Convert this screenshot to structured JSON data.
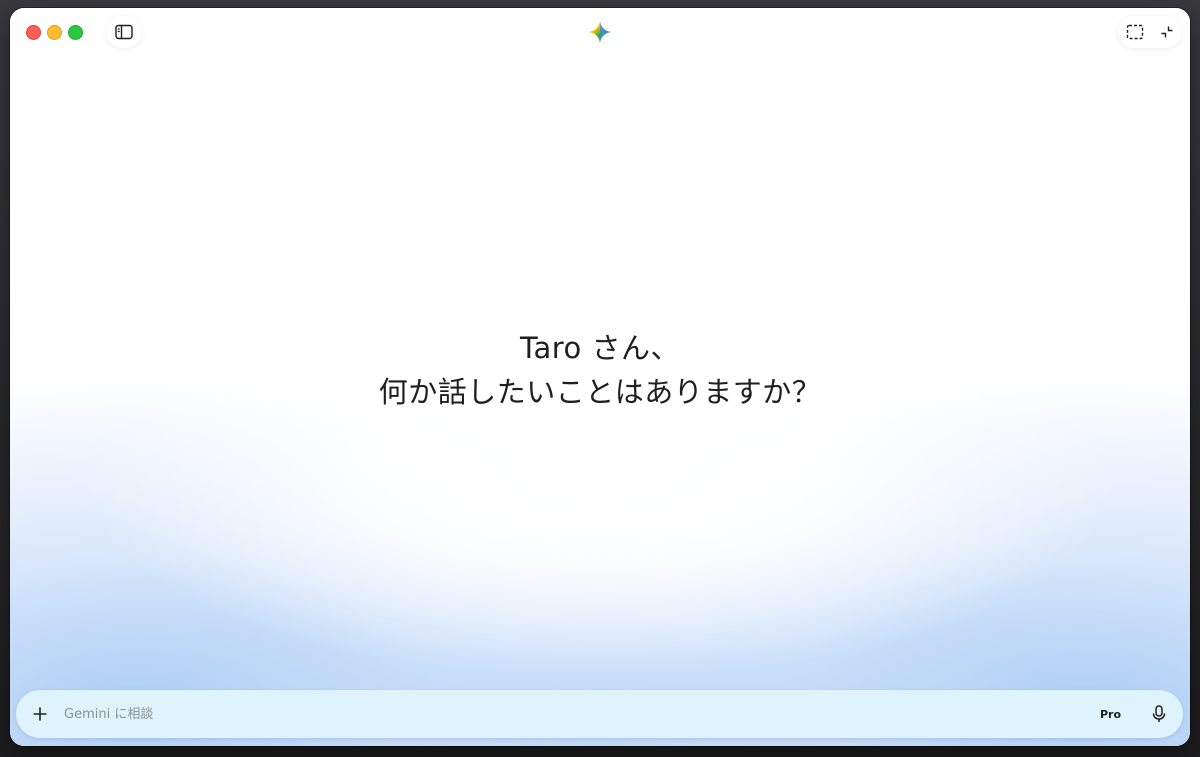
{
  "greeting": {
    "line1": "Taro さん、",
    "line2": "何か話したいことはありますか？"
  },
  "input": {
    "placeholder": "Gemini に相談",
    "value": ""
  },
  "model": {
    "label": "Pro"
  },
  "colors": {
    "input_bg": "#dff3fd",
    "glow_blue": "#aacdf5",
    "close": "#ff5f57",
    "minimize": "#febc2e",
    "zoom": "#28c840",
    "logo_blue": "#4285f4",
    "logo_red": "#ea4335",
    "logo_yellow": "#fbbc04",
    "logo_green": "#34a853"
  },
  "icons": {
    "sidebar": "sidebar-toggle-icon",
    "logo": "gemini-sparkle-icon",
    "capture": "screen-capture-icon",
    "collapse": "collapse-window-icon",
    "add": "plus-icon",
    "mic": "microphone-icon"
  }
}
